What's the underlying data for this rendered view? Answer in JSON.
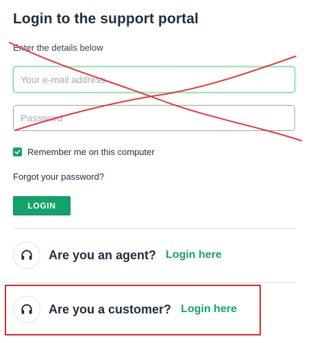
{
  "title": "Login to the support portal",
  "subtitle": "Enter the details below",
  "email": {
    "placeholder": "Your e-mail address"
  },
  "password": {
    "placeholder": "Password"
  },
  "remember": {
    "label": "Remember me on this computer",
    "checked": true
  },
  "forgot_label": "Forgot your password?",
  "login_button_label": "LOGIN",
  "agent": {
    "question": "Are you an agent?",
    "link": "Login here",
    "icon": "headset-icon"
  },
  "customer": {
    "question": "Are you a customer?",
    "link": "Login here",
    "icon": "headset-icon"
  },
  "colors": {
    "accent": "#12a36a",
    "annotation": "#d9262c",
    "text": "#1f2d3d"
  }
}
